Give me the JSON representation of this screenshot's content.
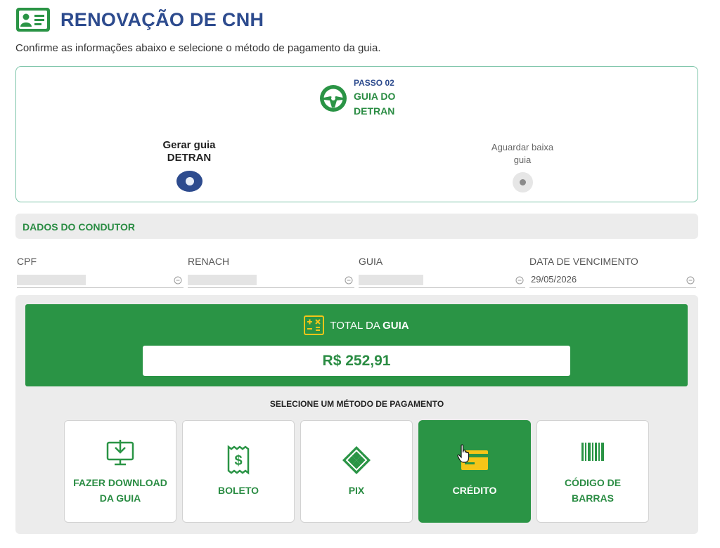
{
  "header": {
    "title": "RENOVAÇÃO DE CNH",
    "icon": "id-card-icon"
  },
  "subtitle": "Confirme as informações abaixo e selecione o método de pagamento da guia.",
  "stepper": {
    "step_number": "PASSO 02",
    "step_name": "GUIA DO DETRAN",
    "left_label": "Gerar guia DETRAN",
    "right_label": "Aguardar baixa guia"
  },
  "section": {
    "title": "DADOS DO CONDUTOR"
  },
  "fields": {
    "cpf_label": "CPF",
    "renach_label": "RENACH",
    "guia_label": "GUIA",
    "vencimento_label": "DATA DE VENCIMENTO",
    "vencimento_value": "29/05/2026"
  },
  "total": {
    "label_prefix": "TOTAL DA ",
    "label_bold": "GUIA",
    "value": "R$ 252,91"
  },
  "payment": {
    "heading": "SELECIONE UM MÉTODO DE PAGAMENTO",
    "methods": [
      {
        "label": "FAZER DOWNLOAD DA GUIA",
        "icon": "download-monitor-icon"
      },
      {
        "label": "BOLETO",
        "icon": "boleto-icon"
      },
      {
        "label": "PIX",
        "icon": "pix-icon"
      },
      {
        "label": "CRÉDITO",
        "icon": "credit-card-icon",
        "selected": true
      },
      {
        "label": "CÓDIGO DE BARRAS",
        "icon": "barcode-icon"
      }
    ]
  },
  "colors": {
    "primary_blue": "#2d4b8e",
    "primary_green": "#2a9445",
    "accent_yellow": "#f5c518"
  }
}
